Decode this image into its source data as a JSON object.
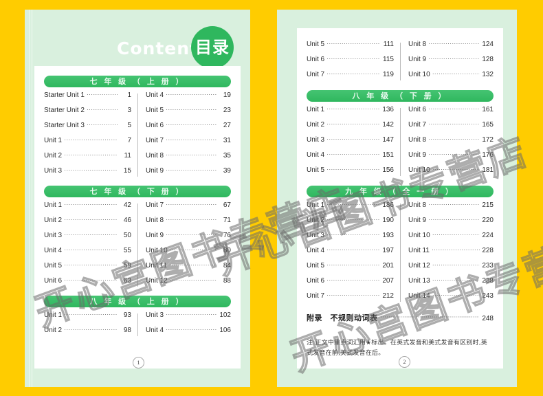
{
  "theme": {
    "border_color": "#ffcc00",
    "page_bg": "#d9f0de",
    "card_bg": "#ffffff",
    "accent_green": "#2fb75e",
    "bar_text": "#e8f9ee"
  },
  "header": {
    "english_title": "Contents",
    "chinese_title": "目录"
  },
  "watermark": {
    "text": "开心宫图书专营店"
  },
  "left_page": {
    "page_number": "1",
    "sections": [
      {
        "title": "七 年 级 （ 上 册 ）",
        "left_column": [
          {
            "label": "Starter Unit 1",
            "page": "1"
          },
          {
            "label": "Starter Unit 2",
            "page": "3"
          },
          {
            "label": "Starter Unit 3",
            "page": "5"
          },
          {
            "label": "Unit 1",
            "page": "7"
          },
          {
            "label": "Unit 2",
            "page": "11"
          },
          {
            "label": "Unit 3",
            "page": "15"
          }
        ],
        "right_column": [
          {
            "label": "Unit 4",
            "page": "19"
          },
          {
            "label": "Unit 5",
            "page": "23"
          },
          {
            "label": "Unit 6",
            "page": "27"
          },
          {
            "label": "Unit 7",
            "page": "31"
          },
          {
            "label": "Unit 8",
            "page": "35"
          },
          {
            "label": "Unit 9",
            "page": "39"
          }
        ]
      },
      {
        "title": "七 年 级 （ 下 册 ）",
        "left_column": [
          {
            "label": "Unit 1",
            "page": "42"
          },
          {
            "label": "Unit 2",
            "page": "46"
          },
          {
            "label": "Unit 3",
            "page": "50"
          },
          {
            "label": "Unit 4",
            "page": "55"
          },
          {
            "label": "Unit 5",
            "page": "59"
          },
          {
            "label": "Unit 6",
            "page": "63"
          }
        ],
        "right_column": [
          {
            "label": "Unit 7",
            "page": "67"
          },
          {
            "label": "Unit 8",
            "page": "71"
          },
          {
            "label": "Unit 9",
            "page": "76"
          },
          {
            "label": "Unit 10",
            "page": "80"
          },
          {
            "label": "Unit 11",
            "page": "84"
          },
          {
            "label": "Unit 12",
            "page": "88"
          }
        ]
      },
      {
        "title": "八 年 级 （ 上 册 ）",
        "left_column": [
          {
            "label": "Unit 1",
            "page": "93"
          },
          {
            "label": "Unit 2",
            "page": "98"
          }
        ],
        "right_column": [
          {
            "label": "Unit 3",
            "page": "102"
          },
          {
            "label": "Unit 4",
            "page": "106"
          }
        ]
      }
    ]
  },
  "right_page": {
    "page_number": "2",
    "continued_section": {
      "left_column": [
        {
          "label": "Unit 5",
          "page": "111"
        },
        {
          "label": "Unit 6",
          "page": "115"
        },
        {
          "label": "Unit 7",
          "page": "119"
        }
      ],
      "right_column": [
        {
          "label": "Unit 8",
          "page": "124"
        },
        {
          "label": "Unit 9",
          "page": "128"
        },
        {
          "label": "Unit 10",
          "page": "132"
        }
      ]
    },
    "sections": [
      {
        "title": "八 年 级 （ 下 册 ）",
        "left_column": [
          {
            "label": "Unit 1",
            "page": "136"
          },
          {
            "label": "Unit 2",
            "page": "142"
          },
          {
            "label": "Unit 3",
            "page": "147"
          },
          {
            "label": "Unit 4",
            "page": "151"
          },
          {
            "label": "Unit 5",
            "page": "156"
          }
        ],
        "right_column": [
          {
            "label": "Unit 6",
            "page": "161"
          },
          {
            "label": "Unit 7",
            "page": "165"
          },
          {
            "label": "Unit 8",
            "page": "172"
          },
          {
            "label": "Unit 9",
            "page": "176"
          },
          {
            "label": "Unit 10",
            "page": "181"
          }
        ]
      },
      {
        "title": "九 年 级 （ 全 一 册 ）",
        "left_column": [
          {
            "label": "Unit 1",
            "page": "186"
          },
          {
            "label": "Unit 2",
            "page": "190"
          },
          {
            "label": "Unit 3",
            "page": "193"
          },
          {
            "label": "Unit 4",
            "page": "197"
          },
          {
            "label": "Unit 5",
            "page": "201"
          },
          {
            "label": "Unit 6",
            "page": "207"
          },
          {
            "label": "Unit 7",
            "page": "212"
          }
        ],
        "right_column": [
          {
            "label": "Unit 8",
            "page": "215"
          },
          {
            "label": "Unit 9",
            "page": "220"
          },
          {
            "label": "Unit 10",
            "page": "224"
          },
          {
            "label": "Unit 11",
            "page": "228"
          },
          {
            "label": "Unit 12",
            "page": "233"
          },
          {
            "label": "Unit 13",
            "page": "238"
          },
          {
            "label": "Unit 14",
            "page": "243"
          }
        ]
      }
    ],
    "appendix": {
      "title": "附录　不规则动词表",
      "page": "248"
    },
    "footnote": "注:正文中重点词汇用★标出。在英式发音和美式发音有区别时,英式发音在前,美式发音在后。"
  }
}
